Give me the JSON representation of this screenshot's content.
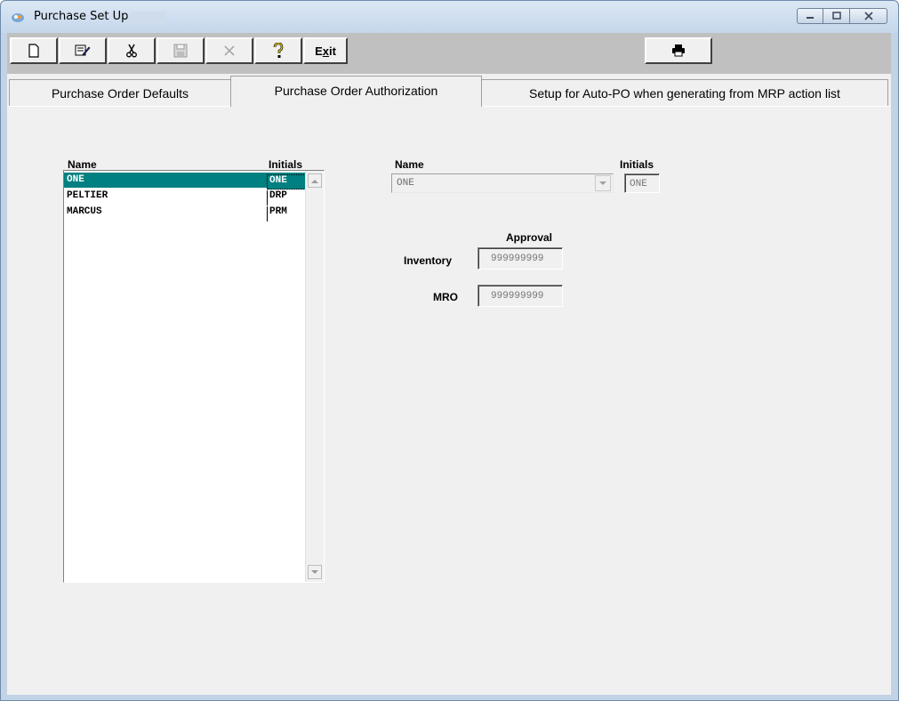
{
  "window": {
    "title": "Purchase Set Up",
    "controls": {
      "minimize": "minimize",
      "maximize": "maximize",
      "close": "close"
    }
  },
  "toolbar": {
    "buttons": [
      {
        "icon": "new-document-icon"
      },
      {
        "icon": "edit-icon"
      },
      {
        "icon": "cut-icon"
      },
      {
        "icon": "save-icon"
      },
      {
        "icon": "cancel-icon"
      },
      {
        "icon": "help-icon"
      },
      {
        "label_pre": "E",
        "label_u": "x",
        "label_post": "it"
      }
    ],
    "print_icon": "print-icon"
  },
  "tabs": [
    {
      "label": "Purchase Order Defaults",
      "active": false
    },
    {
      "label": "Purchase Order Authorization",
      "active": true
    },
    {
      "label": "Setup for Auto-PO when generating from MRP action list",
      "active": false
    }
  ],
  "list": {
    "header_name": "Name",
    "header_initials": "Initials",
    "rows": [
      {
        "name": "ONE",
        "initials": "ONE",
        "selected": true
      },
      {
        "name": "PELTIER",
        "initials": "DRP",
        "selected": false
      },
      {
        "name": "MARCUS",
        "initials": "PRM",
        "selected": false
      }
    ]
  },
  "detail": {
    "name_label": "Name",
    "initials_label": "Initials",
    "name_value": "ONE",
    "initials_value": "ONE",
    "approval_header": "Approval",
    "inventory_label": "Inventory",
    "inventory_value": "999999999",
    "mro_label": "MRO",
    "mro_value": "999999999"
  },
  "colors": {
    "selection": "#008080",
    "toolbar_bg": "#c0c0c0",
    "client_bg": "#f0f0f0"
  }
}
